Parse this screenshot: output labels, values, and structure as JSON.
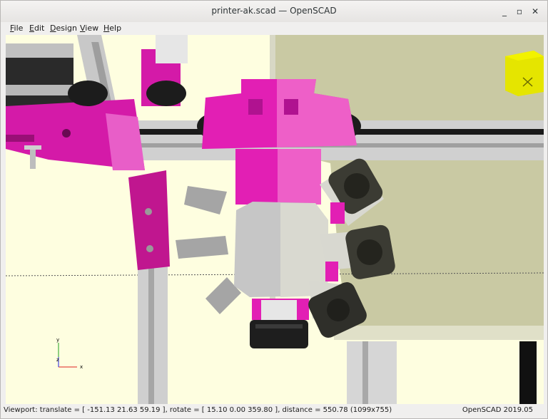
{
  "window": {
    "title": "printer-ak.scad — OpenSCAD",
    "minimize_glyph": "_",
    "maximize_glyph": "▫",
    "close_glyph": "✕"
  },
  "menubar": {
    "items": [
      {
        "underline": "F",
        "rest": "ile"
      },
      {
        "underline": "E",
        "rest": "dit"
      },
      {
        "underline": "D",
        "rest": "esign"
      },
      {
        "underline": "V",
        "rest": "iew"
      },
      {
        "underline": "H",
        "rest": "elp"
      }
    ]
  },
  "axes_gizmo": {
    "x_label": "x",
    "y_label": "y",
    "z_label": "z"
  },
  "status": {
    "viewport_text": "Viewport: translate = [ -151.13 21.63 59.19 ], rotate = [ 15.10 0.00 359.80 ], distance = 550.78 (1099x755)",
    "version": "OpenSCAD 2019.05"
  },
  "colors": {
    "part_magenta": "#e21fb4",
    "fan_black": "#2a2a2a",
    "rail_aluminium": "#c8c8c8",
    "background": "#fefee0",
    "bed_khaki": "#c9c9a3",
    "view_cube_yellow": "#e5e500"
  },
  "icons": [
    "minimize-icon",
    "maximize-icon",
    "close-icon",
    "axes-gizmo-icon",
    "view-cube-icon"
  ]
}
